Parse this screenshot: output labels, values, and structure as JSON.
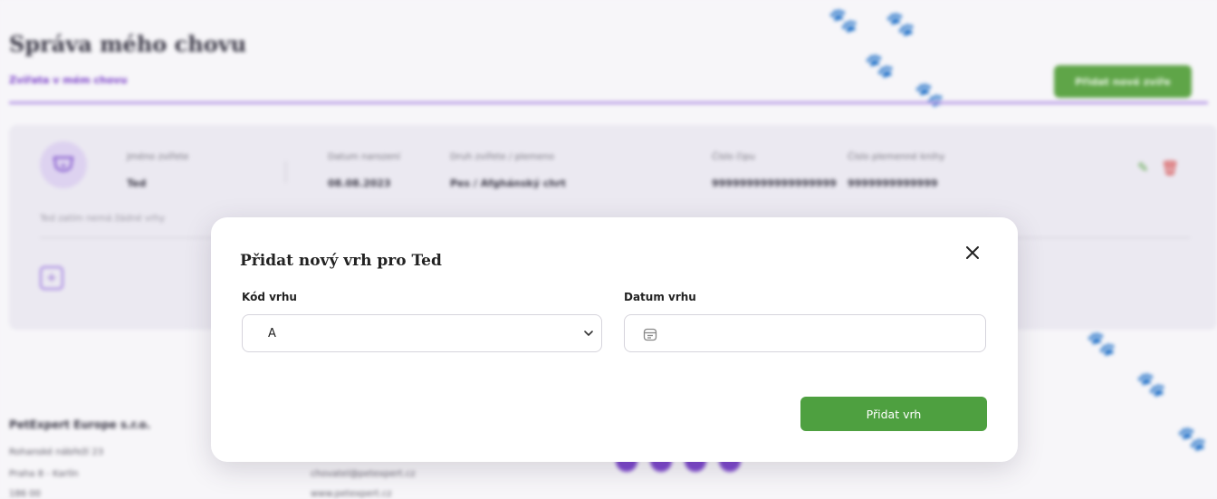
{
  "background": {
    "page_title": "Správa mého chovu",
    "subnav_label": "Zvířata v mém chovu",
    "add_animal_button": "Přidat nové zvíře",
    "animal_card": {
      "name_label": "Jméno zvířete",
      "name_value": "Ted",
      "birth_label": "Datum narození",
      "birth_value": "08.08.2023",
      "species_label": "Druh zvířete / plemeno",
      "species_value": "Pes / Afghánský chrt",
      "chip_label": "Číslo čipu",
      "chip_value": "999999999999999999",
      "studbook_label": "Číslo plemenné knihy",
      "studbook_value": "9999999999999",
      "no_litters_text": "Ted zatím nemá žádné vrhy"
    },
    "footer": {
      "company": "PetExpert Europe s.r.o.",
      "address_line1": "Rohanské nábřeží 23",
      "address_line2": "Praha 8 - Karlín",
      "postcode": "186 00",
      "email": "chovatel@petexpert.cz",
      "website": "www.petexpert.cz"
    }
  },
  "modal": {
    "title": "Přidat nový vrh pro Ted",
    "litter_code_label": "Kód vrhu",
    "litter_code_value": "A",
    "litter_date_label": "Datum vrhu",
    "litter_date_value": "",
    "submit_label": "Přidat vrh"
  },
  "colors": {
    "accent_purple": "#7b45cc",
    "button_green": "#4ea040"
  }
}
